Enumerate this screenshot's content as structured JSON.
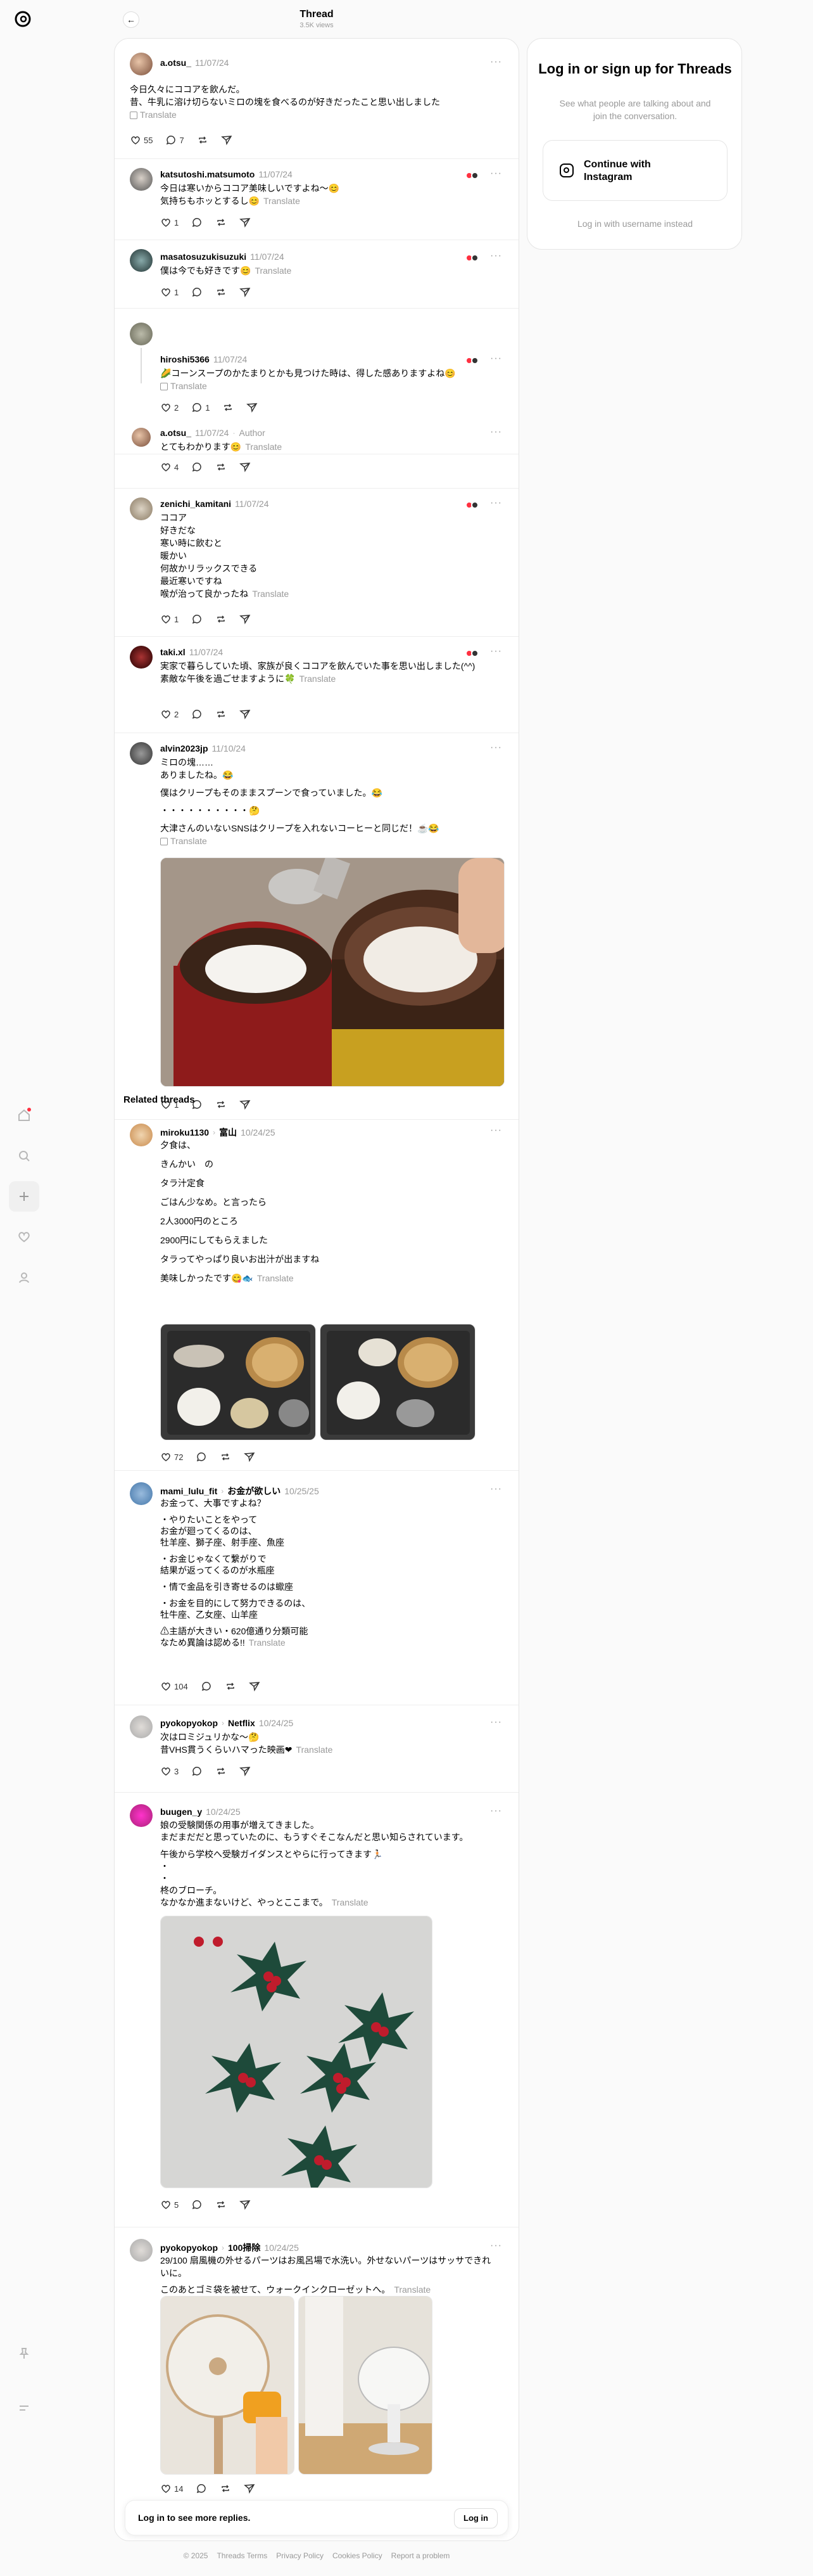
{
  "header": {
    "title": "Thread",
    "views": "3.5K views"
  },
  "nav": {
    "icons": [
      "threads-logo",
      "home-icon",
      "search-icon",
      "plus-icon",
      "heart-icon",
      "profile-icon",
      "pin-icon",
      "menu-icon"
    ]
  },
  "panel": {
    "title": "Log in or sign up for Threads",
    "subtitle": "See what people are talking about and join the conversation.",
    "instagram": "Continue with Instagram",
    "alt": "Log in with username instead"
  },
  "translate": "Translate",
  "posts": [
    {
      "user": "a.otsu_",
      "time": "11/07/24",
      "lines": [
        "今日久々にココアを飲んだ。",
        "昔、牛乳に溶け切らないミロの塊を食べるのが好きだったこと思い出しました"
      ],
      "likes": "55",
      "replies": "7"
    },
    {
      "user": "katsutoshi.matsumoto",
      "time": "11/07/24",
      "lines": [
        "今日は寒いからココア美味しいですよね〜😊",
        "気持ちもホッとするし😊"
      ],
      "likes": "1"
    },
    {
      "user": "masatosuzukisuzuki",
      "time": "11/07/24",
      "lines": [
        "僕は今でも好きです😊"
      ],
      "likes": "1"
    },
    {
      "user": "hiroshi5366",
      "time": "11/07/24",
      "lines": [
        "🌽コーンスープのかたまりとかも見つけた時は、得した感ありますよね😊"
      ],
      "likes": "2",
      "replies": "1"
    },
    {
      "user": "a.otsu_",
      "time": "11/07/24",
      "author": "Author",
      "lines": [
        "とてもわかります😊"
      ],
      "likes": "4"
    },
    {
      "user": "zenichi_kamitani",
      "time": "11/07/24",
      "lines": [
        "ココア",
        "好きだな",
        "寒い時に飲むと",
        "暖かい",
        "何故かリラックスできる",
        "最近寒いですね",
        "喉が治って良かったね"
      ],
      "likes": "1"
    },
    {
      "user": "taki.xl",
      "time": "11/07/24",
      "lines": [
        "実家で暮らしていた頃、家族が良くココアを飲んでいた事を思い出しました(^^)",
        "素敵な午後を過ごせますように🍀"
      ],
      "likes": "2"
    },
    {
      "user": "alvin2023jp",
      "time": "11/10/24",
      "lines": [
        "ミロの塊……",
        "ありましたね。😂",
        "",
        "僕はクリープもそのままスプーンで食っていました。😂",
        "",
        "・・・・・・・・・・🤔",
        "",
        "大津さんのいないSNSはクリープを入れないコーヒーと同じだ！☕😂"
      ],
      "likes": "1"
    }
  ],
  "related": {
    "title": "Related threads",
    "posts": [
      {
        "user": "miroku1130",
        "community": "富山",
        "time": "10/24/25",
        "lines": [
          "夕食は、",
          "",
          "きんかい　の",
          "",
          "タラ汁定食",
          "",
          "ごはん少なめ。と言ったら",
          "",
          "2人3000円のところ",
          "",
          "2900円にしてもらえました",
          "",
          "タラってやっぱり良いお出汁が出ますね",
          "",
          "美味しかったです😋🐟"
        ],
        "likes": "72"
      },
      {
        "user": "mami_lulu_fit",
        "community": "お金が欲しい",
        "time": "10/25/25",
        "lines": [
          "お金って、大事ですよね？",
          "",
          "・やりたいことをやって",
          "お金が廻ってくるのは、",
          "牡羊座、獅子座、射手座、魚座",
          "",
          "・お金じゃなくて繋がりで",
          "結果が返ってくるのが水瓶座",
          "",
          "・情で金品を引き寄せるのは蠍座",
          "",
          "・お金を目的にして努力できるのは、",
          "牡牛座、乙女座、山羊座",
          "",
          "⚠主語が大きい・620億通り分類可能",
          "なため異論は認める!!"
        ],
        "likes": "104"
      },
      {
        "user": "pyokopyokop",
        "community": "Netflix",
        "time": "10/24/25",
        "lines": [
          "次はロミジュリかな〜🤔",
          "昔VHS貫うくらいハマった映画❤"
        ],
        "likes": "3"
      },
      {
        "user": "buugen_y",
        "time": "10/24/25",
        "lines": [
          "娘の受験関係の用事が増えてきました。",
          "まだまだだと思っていたのに、もうすぐそこなんだと思い知らされています。",
          "",
          "午後から学校へ受験ガイダンスとやらに行ってきます🏃🏻",
          "・",
          "・",
          "柊のブローチ。",
          "なかなか進まないけど、やっとここまで。"
        ],
        "likes": "5"
      },
      {
        "user": "pyokopyokop",
        "community": "100掃除",
        "time": "10/24/25",
        "lines": [
          "29/100 扇風機の外せるパーツはお風呂場で水洗い。外せないパーツはサッサできれいに。",
          "",
          "このあとゴミ袋を被せて、ウォークインクローゼットへ。"
        ],
        "likes": "14"
      }
    ]
  },
  "loginbar": {
    "text": "Log in to see more replies.",
    "button": "Log in"
  },
  "footer": [
    "© 2025",
    "Threads Terms",
    "Privacy Policy",
    "Cookies Policy",
    "Report a problem"
  ]
}
